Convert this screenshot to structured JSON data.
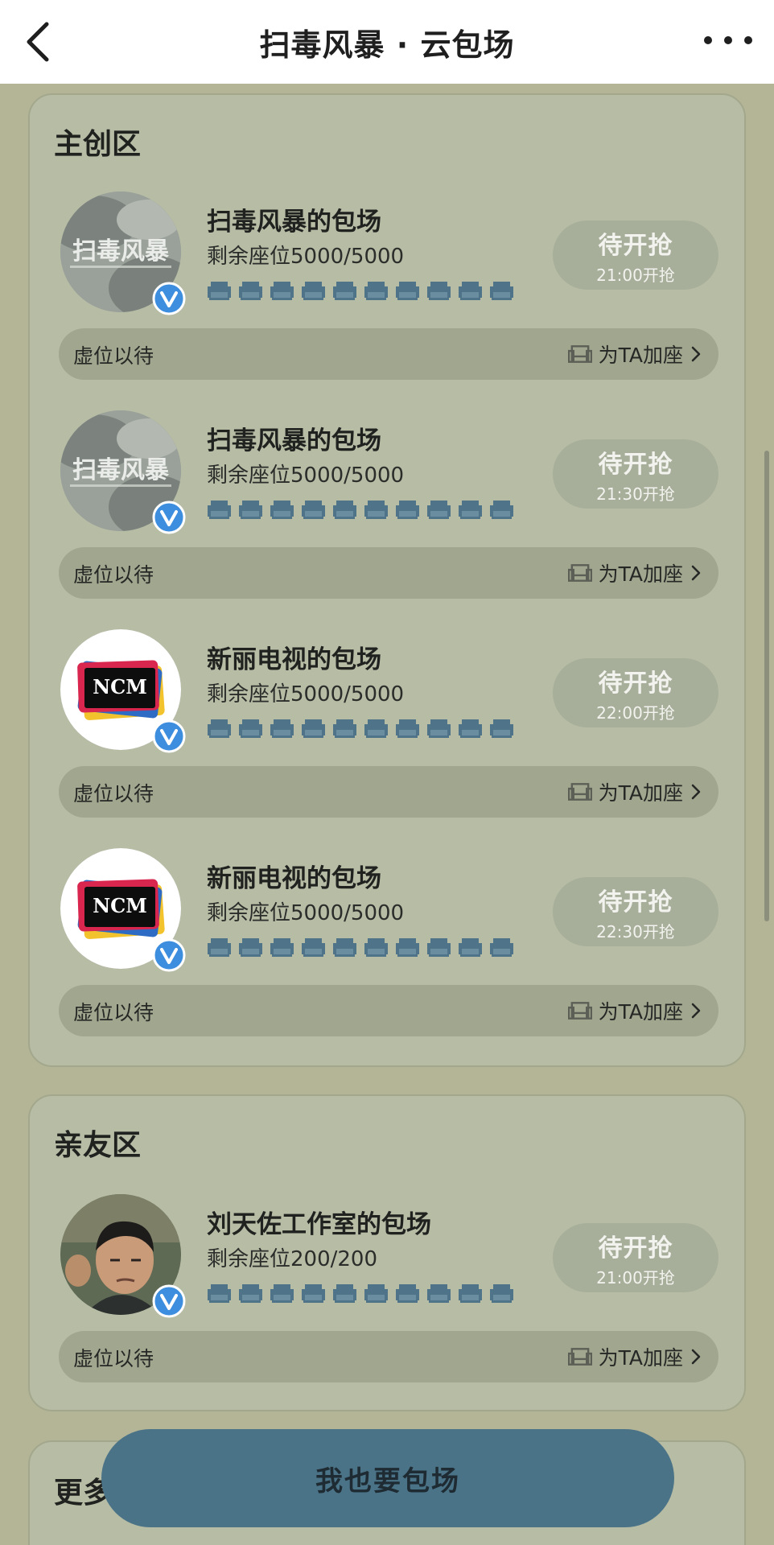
{
  "nav": {
    "title": "扫毒风暴 · 云包场",
    "back_icon": "chevron-left-icon",
    "more_icon": "ellipsis-icon"
  },
  "sections": {
    "main": {
      "title": "主创区",
      "entries": [
        {
          "name": "扫毒风暴的包场",
          "seats": "剩余座位5000/5000",
          "status": "待开抢",
          "time": "21:00开抢",
          "placeholder": "虚位以待",
          "add_seat": "为TA加座",
          "avatar": "sdfb",
          "avatar_text": "扫毒风暴"
        },
        {
          "name": "扫毒风暴的包场",
          "seats": "剩余座位5000/5000",
          "status": "待开抢",
          "time": "21:30开抢",
          "placeholder": "虚位以待",
          "add_seat": "为TA加座",
          "avatar": "sdfb",
          "avatar_text": "扫毒风暴"
        },
        {
          "name": "新丽电视的包场",
          "seats": "剩余座位5000/5000",
          "status": "待开抢",
          "time": "22:00开抢",
          "placeholder": "虚位以待",
          "add_seat": "为TA加座",
          "avatar": "ncm",
          "avatar_text": "NCM"
        },
        {
          "name": "新丽电视的包场",
          "seats": "剩余座位5000/5000",
          "status": "待开抢",
          "time": "22:30开抢",
          "placeholder": "虚位以待",
          "add_seat": "为TA加座",
          "avatar": "ncm",
          "avatar_text": "NCM"
        }
      ]
    },
    "friends": {
      "title": "亲友区",
      "entries": [
        {
          "name": "刘天佐工作室的包场",
          "seats": "剩余座位200/200",
          "status": "待开抢",
          "time": "21:00开抢",
          "placeholder": "虚位以待",
          "add_seat": "为TA加座",
          "avatar": "person"
        }
      ]
    },
    "more": {
      "title": "更多"
    }
  },
  "cta": {
    "label": "我也要包场"
  },
  "colors": {
    "background": "#b3b596",
    "card": "#b7bca5",
    "button": "#4b7387",
    "seat": "#4f7489",
    "verified": "#3d8ede"
  }
}
